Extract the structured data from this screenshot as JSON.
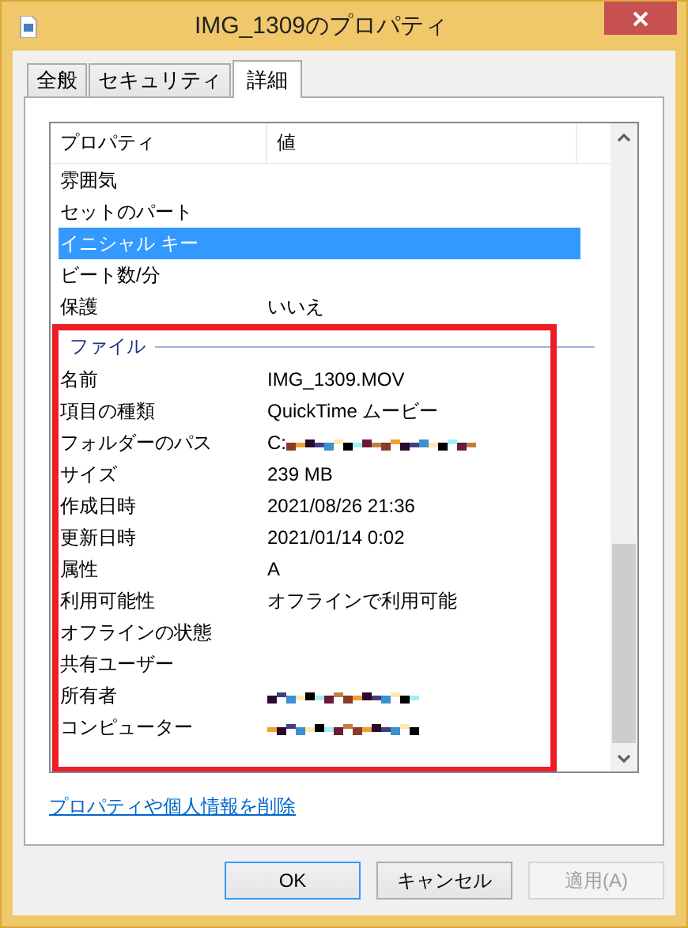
{
  "window": {
    "title": "IMG_1309のプロパティ"
  },
  "tabs": [
    {
      "label": "全般",
      "selected": false
    },
    {
      "label": "セキュリティ",
      "selected": false
    },
    {
      "label": "詳細",
      "selected": true
    }
  ],
  "columns": [
    "プロパティ",
    "値"
  ],
  "rows": [
    {
      "name": "雰囲気",
      "selected": false
    },
    {
      "name": "セットのパート",
      "selected": false
    },
    {
      "name": "イニシャル キー",
      "selected": true
    },
    {
      "name": "ビート数/分",
      "selected": false
    },
    {
      "name": "保護",
      "value": "いいえ",
      "selected": false
    }
  ],
  "file_section": {
    "heading": "ファイル",
    "highlighted": true,
    "rows": [
      {
        "name": "名前",
        "value": "IMG_1309.MOV",
        "selected": false
      },
      {
        "name": "項目の種類",
        "value": "QuickTime ムービー",
        "selected": false
      },
      {
        "name": "フォルダーのパス",
        "value": "C:",
        "redacted": true,
        "selected": false
      },
      {
        "name": "サイズ",
        "value": "239 MB",
        "selected": false
      },
      {
        "name": "作成日時",
        "value": "2021/08/26 21:36",
        "selected": false
      },
      {
        "name": "更新日時",
        "value": "2021/01/14 0:02",
        "selected": false
      },
      {
        "name": "属性",
        "value": "A",
        "selected": false
      },
      {
        "name": "利用可能性",
        "value": "オフラインで利用可能",
        "selected": false
      },
      {
        "name": "オフラインの状態",
        "selected": false
      },
      {
        "name": "共有ユーザー",
        "selected": false
      },
      {
        "name": "所有者",
        "redacted": true,
        "selected": false
      },
      {
        "name": "コンピューター",
        "redacted": true,
        "selected": false
      }
    ]
  },
  "link": "プロパティや個人情報を削除",
  "buttons": [
    {
      "label": "OK",
      "disabled": false,
      "default": true
    },
    {
      "label": "キャンセル",
      "disabled": false,
      "default": false
    },
    {
      "label": "適用(A)",
      "disabled": true,
      "default": false
    }
  ]
}
